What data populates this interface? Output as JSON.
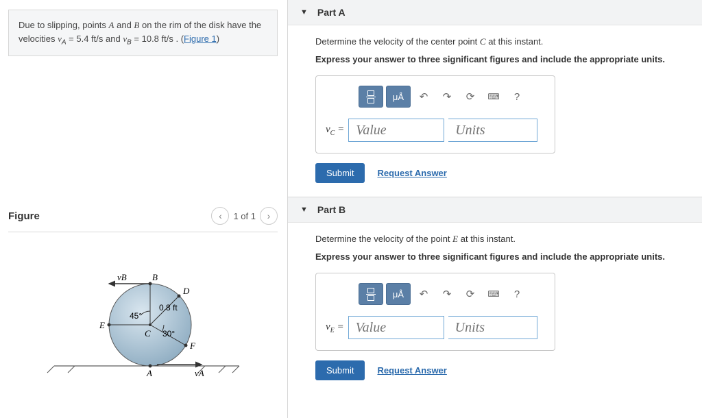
{
  "problem": {
    "prefix": "Due to slipping, points ",
    "pointA": "A",
    "mid1": " and ",
    "pointB": "B",
    "mid2": " on the rim of the disk have the velocities ",
    "vA_sym": "v",
    "vA_sub": "A",
    "vA_val": " = 5.4 ft/s",
    "mid3": " and ",
    "vB_sym": "v",
    "vB_sub": "B",
    "vB_val": " = 10.8 ft/s",
    "suffix": ". (",
    "figure_link": "Figure 1",
    "close": ")"
  },
  "figure": {
    "title": "Figure",
    "pager": "1 of 1"
  },
  "diagram": {
    "vB": "vB",
    "B": "B",
    "D": "D",
    "radius": "0.8 ft",
    "ang45": "45°",
    "ang30": "30°",
    "E": "E",
    "C": "C",
    "F": "F",
    "A": "A",
    "vA": "vA"
  },
  "partA": {
    "title": "Part A",
    "question_pre": "Determine the velocity of the center point ",
    "pointC": "C",
    "question_post": " at this instant.",
    "instruction": "Express your answer to three significant figures and include the appropriate units.",
    "var_label": "v",
    "var_sub": "C",
    "equals": " = ",
    "value_placeholder": "Value",
    "units_placeholder": "Units",
    "submit": "Submit",
    "request": "Request Answer",
    "mua": "μÅ",
    "help": "?"
  },
  "partB": {
    "title": "Part B",
    "question_pre": "Determine the velocity of the point ",
    "pointE": "E",
    "question_post": " at this instant.",
    "instruction": "Express your answer to three significant figures and include the appropriate units.",
    "var_label": "v",
    "var_sub": "E",
    "equals": " = ",
    "value_placeholder": "Value",
    "units_placeholder": "Units",
    "submit": "Submit",
    "request": "Request Answer",
    "mua": "μÅ",
    "help": "?"
  }
}
